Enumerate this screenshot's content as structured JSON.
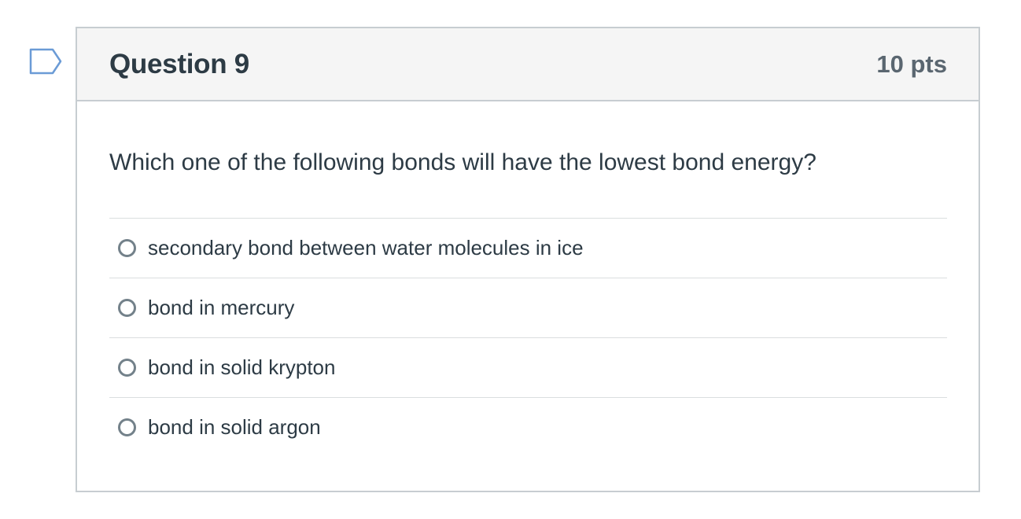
{
  "question": {
    "title": "Question 9",
    "points": "10 pts",
    "text": "Which one of the following bonds will have the lowest bond energy?",
    "answers": [
      {
        "label": "secondary bond between water molecules in ice",
        "selected": false
      },
      {
        "label": "bond in mercury",
        "selected": false
      },
      {
        "label": "bond in solid krypton",
        "selected": false
      },
      {
        "label": "bond in solid argon",
        "selected": false
      }
    ]
  },
  "colors": {
    "flag_stroke": "#6b9bd6",
    "header_bg": "#f5f5f5",
    "border": "#c7cdd1",
    "text": "#2d3b45",
    "points_text": "#5a6670",
    "radio_border": "#73818a"
  },
  "icons": {
    "flag": "bookmark-flag-icon",
    "radio": "radio-button-icon"
  }
}
